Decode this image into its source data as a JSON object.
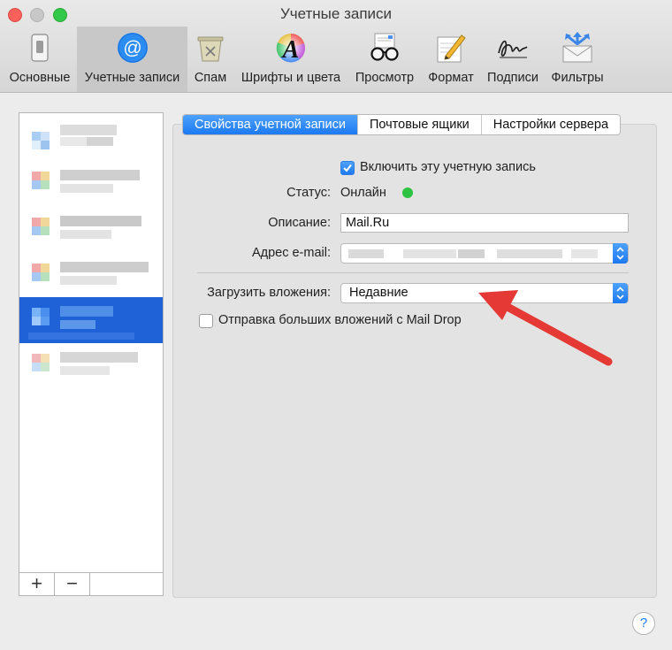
{
  "window": {
    "title": "Учетные записи"
  },
  "toolbar": {
    "items": [
      {
        "label": "Основные",
        "icon": "general-switch-icon"
      },
      {
        "label": "Учетные записи",
        "icon": "accounts-at-icon"
      },
      {
        "label": "Спам",
        "icon": "trash-bin-icon"
      },
      {
        "label": "Шрифты и цвета",
        "icon": "fonts-colors-icon"
      },
      {
        "label": "Просмотр",
        "icon": "glasses-icon"
      },
      {
        "label": "Формат",
        "icon": "pencil-paper-icon"
      },
      {
        "label": "Подписи",
        "icon": "signature-icon"
      },
      {
        "label": "Фильтры",
        "icon": "filters-envelope-icon"
      }
    ]
  },
  "sidebar": {
    "selected_index": 4,
    "add_label": "+",
    "remove_label": "−"
  },
  "tabs": {
    "items": [
      "Свойства учетной записи",
      "Почтовые ящики",
      "Настройки сервера"
    ],
    "selected_index": 0
  },
  "form": {
    "enable_label": "Включить эту учетную запись",
    "enable_checked": true,
    "status_label": "Статус:",
    "status_value": "Онлайн",
    "status_color": "#2dc241",
    "description_label": "Описание:",
    "description_value": "Mail.Ru",
    "email_label": "Адрес e-mail:",
    "attachments_label": "Загрузить вложения:",
    "attachments_value": "Недавние",
    "maildrop_label": "Отправка больших вложений с Mail Drop",
    "maildrop_checked": false
  },
  "help": {
    "label": "?"
  },
  "colors": {
    "accent": "#1c79f1",
    "annotation_arrow": "#e53935"
  }
}
